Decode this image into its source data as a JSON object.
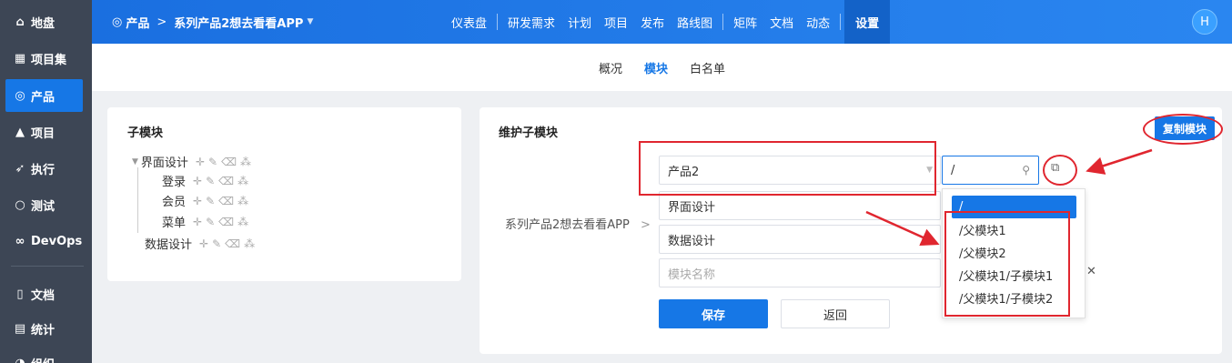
{
  "sidebar": {
    "items": [
      {
        "icon": "home-icon",
        "glyph": "⌂",
        "label": "地盘"
      },
      {
        "icon": "grid-icon",
        "glyph": "▦",
        "label": "项目集"
      },
      {
        "icon": "bulb-icon",
        "glyph": "◎",
        "label": "产品"
      },
      {
        "icon": "rocket-icon",
        "glyph": "▲",
        "label": "项目"
      },
      {
        "icon": "run-icon",
        "glyph": "➶",
        "label": "执行"
      },
      {
        "icon": "search-icon",
        "glyph": "○",
        "label": "测试"
      },
      {
        "icon": "infinity-icon",
        "glyph": "∞",
        "label": "DevOps"
      },
      {
        "icon": "doc-icon",
        "glyph": "▯",
        "label": "文档"
      },
      {
        "icon": "chart-icon",
        "glyph": "▤",
        "label": "统计"
      },
      {
        "icon": "org-icon",
        "glyph": "◔",
        "label": "组织"
      }
    ]
  },
  "header": {
    "module": "产品",
    "separator": ">",
    "product": "系列产品2想去看看APP",
    "nav": [
      "仪表盘",
      "研发需求",
      "计划",
      "项目",
      "发布",
      "路线图",
      "矩阵",
      "文档",
      "动态",
      "设置"
    ],
    "avatar": "H"
  },
  "subtabs": [
    "概况",
    "模块",
    "白名单"
  ],
  "left_card": {
    "title": "子模块",
    "tree": [
      {
        "label": "界面设计",
        "level": 0
      },
      {
        "label": "登录",
        "level": 1
      },
      {
        "label": "会员",
        "level": 1
      },
      {
        "label": "菜单",
        "level": 1
      },
      {
        "label": "数据设计",
        "level": 0
      }
    ]
  },
  "right_card": {
    "title": "维护子模块",
    "copy_button": "复制模块",
    "product_select": "产品2",
    "module_search": "/",
    "parent_label": "系列产品2想去看看APP",
    "parent_arrow": ">",
    "rows": [
      "界面设计",
      "数据设计"
    ],
    "name_placeholder": "模块名称",
    "remove_glyph": "✕",
    "save": "保存",
    "back": "返回",
    "dropdown": [
      "/",
      "/父模块1",
      "/父模块2",
      "/父模块1/子模块1",
      "/父模块1/子模块2"
    ]
  },
  "colors": {
    "accent": "#1677e6",
    "sidebar": "#3d4655",
    "annotation": "#e0262f"
  }
}
